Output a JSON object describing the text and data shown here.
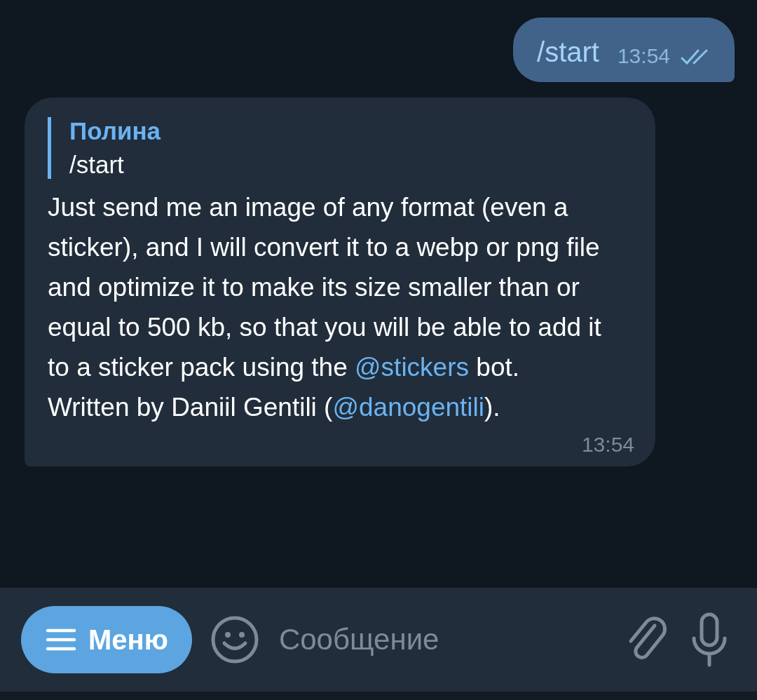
{
  "messages": [
    {
      "kind": "outgoing",
      "text": "/start",
      "time": "13:54",
      "read": true
    },
    {
      "kind": "incoming",
      "reply": {
        "author": "Полина",
        "text": "/start"
      },
      "parts": [
        {
          "kind": "text",
          "text": "Just send me an image of any format (even a sticker), and I will convert it to a webp or png file and optimize it to make its size smaller than or equal to 500 kb, so that you will be able to add it to a sticker pack using the "
        },
        {
          "kind": "mention",
          "text": "@stickers"
        },
        {
          "kind": "text",
          "text": " bot.\nWritten by Daniil Gentili ("
        },
        {
          "kind": "mention",
          "text": "@danogentili"
        },
        {
          "kind": "text",
          "text": ")."
        }
      ],
      "time": "13:54"
    }
  ],
  "composer": {
    "menu_label": "Меню",
    "placeholder": "Сообщение"
  }
}
